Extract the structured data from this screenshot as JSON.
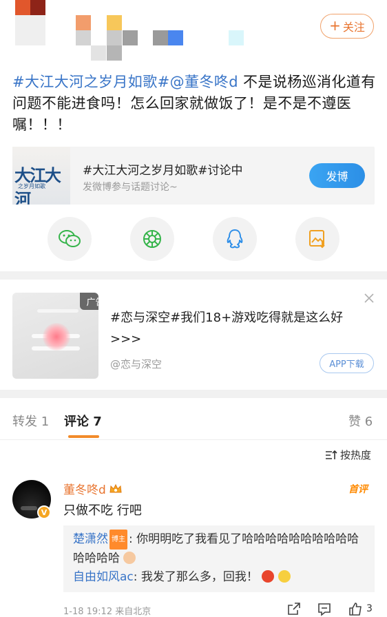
{
  "header": {
    "follow_label": "关注",
    "follow_plus": "+"
  },
  "post": {
    "topic1": "#大江大河之岁月如歌#",
    "mention": "@董冬咚d",
    "text": " 不是说杨巡消化道有问题不能进食吗！怎么回家就做饭了！是不是不遵医嘱！！！"
  },
  "topic_card": {
    "thumb_logo": "大江大河",
    "thumb_sub": "之岁月如歌",
    "title": "#大江大河之岁月如歌#讨论中",
    "subtitle": "发微博参与话题讨论~",
    "post_button": "发博"
  },
  "share": {
    "icons": [
      "wechat-icon",
      "moments-icon",
      "qq-icon",
      "save-image-icon"
    ]
  },
  "ad": {
    "label": "广告",
    "text": "#恋与深空#我们18+游戏吃得就是这么好>>>",
    "source": "@恋与深空",
    "app_button": "APP下载"
  },
  "tabs": {
    "repost": "转发 1",
    "comments": "评论 7",
    "likes": "赞 6"
  },
  "sort_label": "按热度",
  "comment": {
    "author": "董冬咚d",
    "hot_badge": "首评",
    "text": "只做不吃 行吧",
    "verified": "V",
    "replies": [
      {
        "name": "楚潇然",
        "tag": "博主",
        "text": ": 你明明吃了我看见了哈哈哈哈哈哈哈哈哈哈哈哈哈哈"
      },
      {
        "name": "自由如风ac",
        "tag": "",
        "text": ": 我发了那么多，回我！"
      }
    ],
    "time": "1-18 19:12",
    "location": "来自北京",
    "like_count": "3"
  },
  "colors": {
    "accent_orange": "#e8742f",
    "link_blue": "#3874c7",
    "button_blue": "#2c8fe6"
  }
}
